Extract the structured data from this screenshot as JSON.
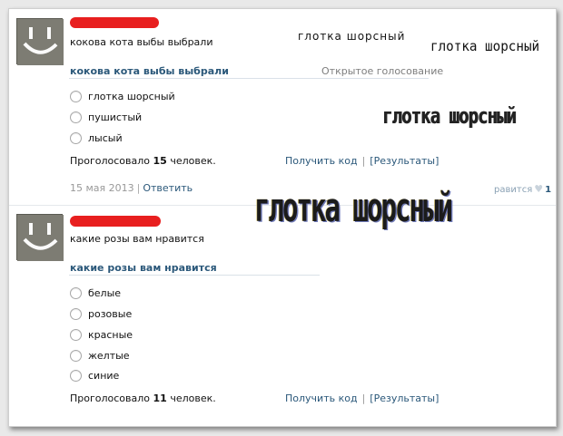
{
  "posts": [
    {
      "text": "кокова кота выбы выбрали",
      "poll": {
        "title": "кокова кота выбы выбрали",
        "type_label": "Открытое голосование",
        "options": [
          "глотка шорсный",
          "пушистый",
          "лысый"
        ],
        "votes_prefix": "Проголосовало ",
        "votes_count": "15",
        "votes_suffix": " человек.",
        "get_code": "Получить код",
        "results": "[Результаты]"
      },
      "date": "15 мая 2013",
      "reply": "Ответить",
      "like_text": "равится",
      "like_count": "1"
    },
    {
      "text": "какие розы вам нравится",
      "poll": {
        "title": "какие розы вам нравится",
        "options": [
          "белые",
          "розовые",
          "красные",
          "желтые",
          "синие"
        ],
        "votes_prefix": "Проголосовало ",
        "votes_count": "11",
        "votes_suffix": " человек.",
        "get_code": "Получить код",
        "results": "[Результаты]"
      }
    }
  ],
  "overlays": [
    "глотка шорсный",
    "глотка шорсный",
    "глотка шорсный",
    "глотка шорсный"
  ],
  "icons": {
    "avatar": "smiley-face-icon",
    "like": "heart-icon"
  },
  "colors": {
    "link": "#2b587a",
    "name_redaction": "#e81f1f",
    "muted": "#999999"
  }
}
